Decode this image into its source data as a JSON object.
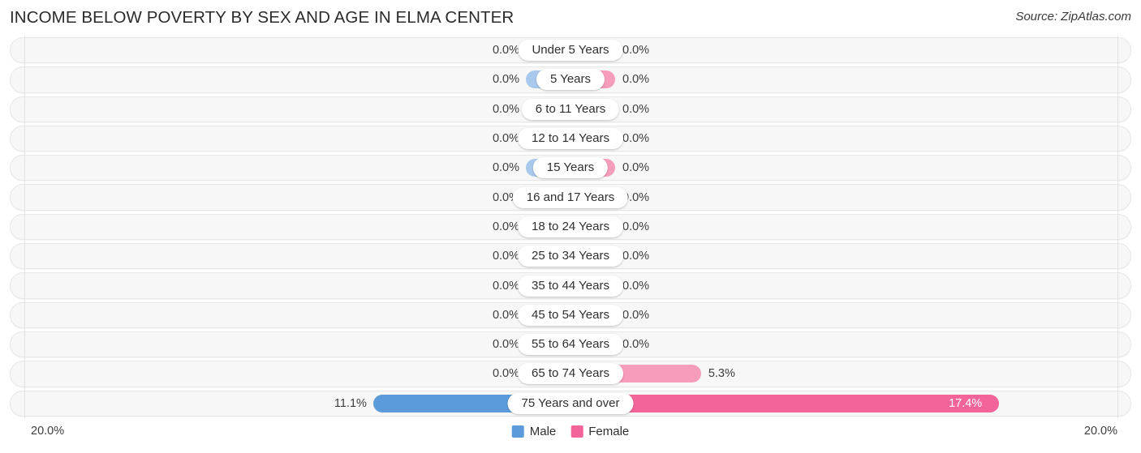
{
  "header": {
    "title": "INCOME BELOW POVERTY BY SEX AND AGE IN ELMA CENTER",
    "source": "Source: ZipAtlas.com"
  },
  "axis": {
    "left_label": "20.0%",
    "right_label": "20.0%"
  },
  "legend": {
    "male_label": "Male",
    "female_label": "Female",
    "male_color": "#5b9bd9",
    "female_color": "#f2649a"
  },
  "colors": {
    "male_muted": "#a9c9ec",
    "female_muted": "#f79dbc",
    "male_strong": "#5b9bd9",
    "female_strong": "#f2649a"
  },
  "chart_data": {
    "type": "bar",
    "title": "INCOME BELOW POVERTY BY SEX AND AGE IN ELMA CENTER",
    "subtitle": "Source: ZipAtlas.com",
    "orientation": "horizontal-diverging",
    "xlabel": "",
    "ylabel": "",
    "xlim": [
      0,
      20.0
    ],
    "grid": false,
    "legend_position": "bottom-center",
    "categories": [
      "Under 5 Years",
      "5 Years",
      "6 to 11 Years",
      "12 to 14 Years",
      "15 Years",
      "16 and 17 Years",
      "18 to 24 Years",
      "25 to 34 Years",
      "35 to 44 Years",
      "45 to 54 Years",
      "55 to 64 Years",
      "65 to 74 Years",
      "75 Years and over"
    ],
    "series": [
      {
        "name": "Male",
        "values": [
          0.0,
          0.0,
          0.0,
          0.0,
          0.0,
          0.0,
          0.0,
          0.0,
          0.0,
          0.0,
          0.0,
          0.0,
          11.1
        ],
        "labels": [
          "0.0%",
          "0.0%",
          "0.0%",
          "0.0%",
          "0.0%",
          "0.0%",
          "0.0%",
          "0.0%",
          "0.0%",
          "0.0%",
          "0.0%",
          "0.0%",
          "11.1%"
        ]
      },
      {
        "name": "Female",
        "values": [
          0.0,
          0.0,
          0.0,
          0.0,
          0.0,
          0.0,
          0.0,
          0.0,
          0.0,
          0.0,
          0.0,
          5.3,
          17.4
        ],
        "labels": [
          "0.0%",
          "0.0%",
          "0.0%",
          "0.0%",
          "0.0%",
          "0.0%",
          "0.0%",
          "0.0%",
          "0.0%",
          "0.0%",
          "0.0%",
          "5.3%",
          "17.4%"
        ]
      }
    ]
  }
}
